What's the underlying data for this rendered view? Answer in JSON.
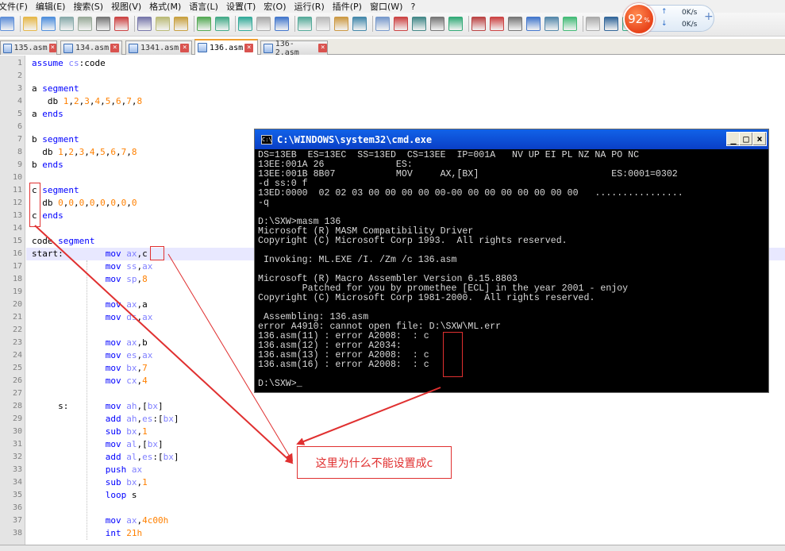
{
  "menu": [
    "文件(F)",
    "编辑(E)",
    "搜索(S)",
    "视图(V)",
    "格式(M)",
    "语言(L)",
    "设置(T)",
    "宏(O)",
    "运行(R)",
    "插件(P)",
    "窗口(W)",
    "?"
  ],
  "netmon": {
    "percent": "92",
    "percent_sign": "%",
    "up": "0K/s",
    "down": "0K/s",
    "plus": "+"
  },
  "tabs": [
    {
      "label": "135.asm"
    },
    {
      "label": "134.asm"
    },
    {
      "label": "1341.asm"
    },
    {
      "label": "136.asm"
    },
    {
      "label": "136-2.asm"
    }
  ],
  "editor": {
    "line_numbers": [
      "1",
      "2",
      "3",
      "4",
      "5",
      "6",
      "7",
      "8",
      "9",
      "10",
      "11",
      "12",
      "13",
      "14",
      "15",
      "16",
      "17",
      "18",
      "19",
      "20",
      "21",
      "22",
      "23",
      "24",
      "25",
      "26",
      "27",
      "28",
      "29",
      "30",
      "31",
      "32",
      "33",
      "34",
      "35",
      "36",
      "37",
      "38"
    ],
    "lines": [
      [
        [
          "k",
          "assume"
        ],
        [
          "p",
          " "
        ],
        [
          "r",
          "cs"
        ],
        [
          "p",
          ":code"
        ]
      ],
      [],
      [
        [
          "p",
          "a "
        ],
        [
          "k",
          "segment"
        ]
      ],
      [
        [
          "p",
          "   "
        ],
        [
          "p",
          "db "
        ],
        [
          "n",
          "1"
        ],
        [
          "p",
          ","
        ],
        [
          "n",
          "2"
        ],
        [
          "p",
          ","
        ],
        [
          "n",
          "3"
        ],
        [
          "p",
          ","
        ],
        [
          "n",
          "4"
        ],
        [
          "p",
          ","
        ],
        [
          "n",
          "5"
        ],
        [
          "p",
          ","
        ],
        [
          "n",
          "6"
        ],
        [
          "p",
          ","
        ],
        [
          "n",
          "7"
        ],
        [
          "p",
          ","
        ],
        [
          "n",
          "8"
        ]
      ],
      [
        [
          "p",
          "a "
        ],
        [
          "k",
          "ends"
        ]
      ],
      [],
      [
        [
          "p",
          "b "
        ],
        [
          "k",
          "segment"
        ]
      ],
      [
        [
          "p",
          "  "
        ],
        [
          "p",
          "db "
        ],
        [
          "n",
          "1"
        ],
        [
          "p",
          ","
        ],
        [
          "n",
          "2"
        ],
        [
          "p",
          ","
        ],
        [
          "n",
          "3"
        ],
        [
          "p",
          ","
        ],
        [
          "n",
          "4"
        ],
        [
          "p",
          ","
        ],
        [
          "n",
          "5"
        ],
        [
          "p",
          ","
        ],
        [
          "n",
          "6"
        ],
        [
          "p",
          ","
        ],
        [
          "n",
          "7"
        ],
        [
          "p",
          ","
        ],
        [
          "n",
          "8"
        ]
      ],
      [
        [
          "p",
          "b "
        ],
        [
          "k",
          "ends"
        ]
      ],
      [],
      [
        [
          "p",
          "c "
        ],
        [
          "k",
          "segment"
        ]
      ],
      [
        [
          "p",
          "  "
        ],
        [
          "p",
          "db "
        ],
        [
          "n",
          "0"
        ],
        [
          "p",
          ","
        ],
        [
          "n",
          "0"
        ],
        [
          "p",
          ","
        ],
        [
          "n",
          "0"
        ],
        [
          "p",
          ","
        ],
        [
          "n",
          "0"
        ],
        [
          "p",
          ","
        ],
        [
          "n",
          "0"
        ],
        [
          "p",
          ","
        ],
        [
          "n",
          "0"
        ],
        [
          "p",
          ","
        ],
        [
          "n",
          "0"
        ],
        [
          "p",
          ","
        ],
        [
          "n",
          "0"
        ]
      ],
      [
        [
          "p",
          "c "
        ],
        [
          "k",
          "ends"
        ]
      ],
      [],
      [
        [
          "p",
          "code "
        ],
        [
          "k",
          "segment"
        ]
      ],
      [
        [
          "p",
          "start:"
        ],
        [
          "p",
          "        "
        ],
        [
          "k",
          "mov"
        ],
        [
          "p",
          " "
        ],
        [
          "r",
          "ax"
        ],
        [
          "p",
          ",c"
        ]
      ],
      [
        [
          "p",
          "              "
        ],
        [
          "k",
          "mov"
        ],
        [
          "p",
          " "
        ],
        [
          "r",
          "ss"
        ],
        [
          "p",
          ","
        ],
        [
          "r",
          "ax"
        ]
      ],
      [
        [
          "p",
          "              "
        ],
        [
          "k",
          "mov"
        ],
        [
          "p",
          " "
        ],
        [
          "r",
          "sp"
        ],
        [
          "p",
          ","
        ],
        [
          "n",
          "8"
        ]
      ],
      [],
      [
        [
          "p",
          "              "
        ],
        [
          "k",
          "mov"
        ],
        [
          "p",
          " "
        ],
        [
          "r",
          "ax"
        ],
        [
          "p",
          ",a"
        ]
      ],
      [
        [
          "p",
          "              "
        ],
        [
          "k",
          "mov"
        ],
        [
          "p",
          " "
        ],
        [
          "r",
          "ds"
        ],
        [
          "p",
          ","
        ],
        [
          "r",
          "ax"
        ]
      ],
      [],
      [
        [
          "p",
          "              "
        ],
        [
          "k",
          "mov"
        ],
        [
          "p",
          " "
        ],
        [
          "r",
          "ax"
        ],
        [
          "p",
          ",b"
        ]
      ],
      [
        [
          "p",
          "              "
        ],
        [
          "k",
          "mov"
        ],
        [
          "p",
          " "
        ],
        [
          "r",
          "es"
        ],
        [
          "p",
          ","
        ],
        [
          "r",
          "ax"
        ]
      ],
      [
        [
          "p",
          "              "
        ],
        [
          "k",
          "mov"
        ],
        [
          "p",
          " "
        ],
        [
          "r",
          "bx"
        ],
        [
          "p",
          ","
        ],
        [
          "n",
          "7"
        ]
      ],
      [
        [
          "p",
          "              "
        ],
        [
          "k",
          "mov"
        ],
        [
          "p",
          " "
        ],
        [
          "r",
          "cx"
        ],
        [
          "p",
          ","
        ],
        [
          "n",
          "4"
        ]
      ],
      [],
      [
        [
          "p",
          "     s:       "
        ],
        [
          "k",
          "mov"
        ],
        [
          "p",
          " "
        ],
        [
          "r",
          "ah"
        ],
        [
          "p",
          ",["
        ],
        [
          "r",
          "bx"
        ],
        [
          "p",
          "]"
        ]
      ],
      [
        [
          "p",
          "              "
        ],
        [
          "k",
          "add"
        ],
        [
          "p",
          " "
        ],
        [
          "r",
          "ah"
        ],
        [
          "p",
          ","
        ],
        [
          "r",
          "es"
        ],
        [
          "p",
          ":["
        ],
        [
          "r",
          "bx"
        ],
        [
          "p",
          "]"
        ]
      ],
      [
        [
          "p",
          "              "
        ],
        [
          "k",
          "sub"
        ],
        [
          "p",
          " "
        ],
        [
          "r",
          "bx"
        ],
        [
          "p",
          ","
        ],
        [
          "n",
          "1"
        ]
      ],
      [
        [
          "p",
          "              "
        ],
        [
          "k",
          "mov"
        ],
        [
          "p",
          " "
        ],
        [
          "r",
          "al"
        ],
        [
          "p",
          ",["
        ],
        [
          "r",
          "bx"
        ],
        [
          "p",
          "]"
        ]
      ],
      [
        [
          "p",
          "              "
        ],
        [
          "k",
          "add"
        ],
        [
          "p",
          " "
        ],
        [
          "r",
          "al"
        ],
        [
          "p",
          ","
        ],
        [
          "r",
          "es"
        ],
        [
          "p",
          ":["
        ],
        [
          "r",
          "bx"
        ],
        [
          "p",
          "]"
        ]
      ],
      [
        [
          "p",
          "              "
        ],
        [
          "k",
          "push"
        ],
        [
          "p",
          " "
        ],
        [
          "r",
          "ax"
        ]
      ],
      [
        [
          "p",
          "              "
        ],
        [
          "k",
          "sub"
        ],
        [
          "p",
          " "
        ],
        [
          "r",
          "bx"
        ],
        [
          "p",
          ","
        ],
        [
          "n",
          "1"
        ]
      ],
      [
        [
          "p",
          "              "
        ],
        [
          "k",
          "loop"
        ],
        [
          "p",
          " s"
        ]
      ],
      [],
      [
        [
          "p",
          "              "
        ],
        [
          "k",
          "mov"
        ],
        [
          "p",
          " "
        ],
        [
          "r",
          "ax"
        ],
        [
          "p",
          ","
        ],
        [
          "n",
          "4c00h"
        ]
      ],
      [
        [
          "p",
          "              "
        ],
        [
          "k",
          "int"
        ],
        [
          "p",
          " "
        ],
        [
          "n",
          "21h"
        ]
      ]
    ]
  },
  "cmd": {
    "title": "C:\\WINDOWS\\system32\\cmd.exe",
    "icon_text": "C:\\",
    "buttons": {
      "min": "_",
      "max": "□",
      "close": "×"
    },
    "lines": [
      "DS=13EB  ES=13EC  SS=13ED  CS=13EE  IP=001A   NV UP EI PL NZ NA PO NC",
      "13EE:001A 26             ES:",
      "13EE:001B 8B07           MOV     AX,[BX]                        ES:0001=0302",
      "-d ss:0 f",
      "13ED:0000  02 02 03 00 00 00 00 00-00 00 00 00 00 00 00 00   ................",
      "-q",
      "",
      "D:\\SXW>masm 136",
      "Microsoft (R) MASM Compatibility Driver",
      "Copyright (C) Microsoft Corp 1993.  All rights reserved.",
      "",
      " Invoking: ML.EXE /I. /Zm /c 136.asm",
      "",
      "Microsoft (R) Macro Assembler Version 6.15.8803",
      "        Patched for you by promethee [ECL] in the year 2001 - enjoy",
      "Copyright (C) Microsoft Corp 1981-2000.  All rights reserved.",
      "",
      " Assembling: 136.asm",
      "error A4910: cannot open file: D:\\SXW\\ML.err",
      "136.asm(11) : error A2008:  : c",
      "136.asm(12) : error A2034:",
      "136.asm(13) : error A2008:  : c",
      "136.asm(16) : error A2008:  : c",
      "",
      "D:\\SXW>_"
    ]
  },
  "callout": {
    "text": "这里为什么不能设置成c"
  },
  "colors": {
    "annotation": "#e03030",
    "keyword": "#0000ff",
    "register": "#8080ff",
    "number": "#ff8000"
  }
}
